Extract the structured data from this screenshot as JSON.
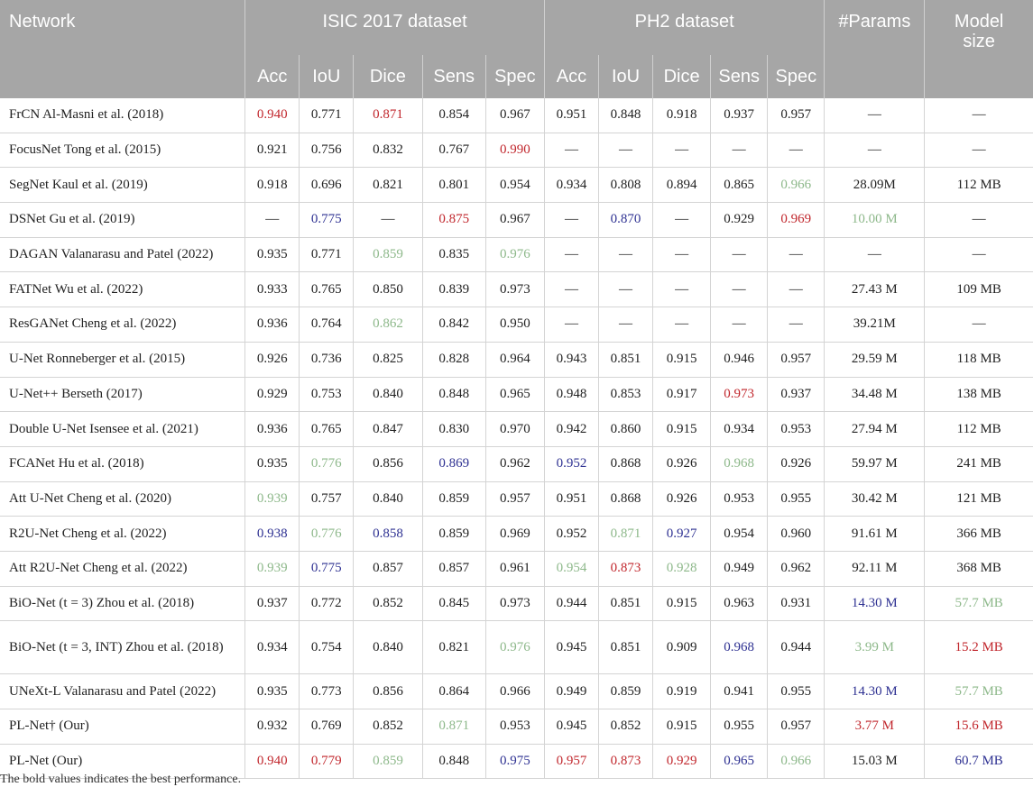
{
  "header": {
    "network": "Network",
    "group1": "ISIC 2017 dataset",
    "group2": "PH2 dataset",
    "params": "#Params",
    "model_size_line1": "Model",
    "model_size_line2": "size",
    "metrics": [
      "Acc",
      "IoU",
      "Dice",
      "Sens",
      "Spec"
    ]
  },
  "colors": {
    "header_bg": "#a6a6a6",
    "red": "#c1272d",
    "blue": "#2e3192",
    "green": "#8db88a"
  },
  "rows": [
    {
      "name": "FrCN Al-Masni et al. (2018)",
      "cells": [
        {
          "v": "0.940",
          "c": "red"
        },
        {
          "v": "0.771"
        },
        {
          "v": "0.871",
          "c": "red"
        },
        {
          "v": "0.854"
        },
        {
          "v": "0.967"
        },
        {
          "v": "0.951"
        },
        {
          "v": "0.848"
        },
        {
          "v": "0.918"
        },
        {
          "v": "0.937"
        },
        {
          "v": "0.957"
        },
        {
          "v": "—"
        },
        {
          "v": "—"
        }
      ]
    },
    {
      "name": "FocusNet Tong et al. (2015)",
      "cells": [
        {
          "v": "0.921"
        },
        {
          "v": "0.756"
        },
        {
          "v": "0.832"
        },
        {
          "v": "0.767"
        },
        {
          "v": "0.990",
          "c": "red"
        },
        {
          "v": "—"
        },
        {
          "v": "—"
        },
        {
          "v": "—"
        },
        {
          "v": "—"
        },
        {
          "v": "—"
        },
        {
          "v": "—"
        },
        {
          "v": "—"
        }
      ]
    },
    {
      "name": "SegNet Kaul et al. (2019)",
      "cells": [
        {
          "v": "0.918"
        },
        {
          "v": "0.696"
        },
        {
          "v": "0.821"
        },
        {
          "v": "0.801"
        },
        {
          "v": "0.954"
        },
        {
          "v": "0.934"
        },
        {
          "v": "0.808"
        },
        {
          "v": "0.894"
        },
        {
          "v": "0.865"
        },
        {
          "v": "0.966",
          "c": "green"
        },
        {
          "v": "28.09M"
        },
        {
          "v": "112 MB"
        }
      ]
    },
    {
      "name": "DSNet Gu et al. (2019)",
      "cells": [
        {
          "v": "—"
        },
        {
          "v": "0.775",
          "c": "blue"
        },
        {
          "v": "—"
        },
        {
          "v": "0.875",
          "c": "red"
        },
        {
          "v": "0.967"
        },
        {
          "v": "—"
        },
        {
          "v": "0.870",
          "c": "blue"
        },
        {
          "v": "—"
        },
        {
          "v": "0.929"
        },
        {
          "v": "0.969",
          "c": "red"
        },
        {
          "v": "10.00 M",
          "c": "green"
        },
        {
          "v": "—"
        }
      ]
    },
    {
      "name": "DAGAN Valanarasu and Patel (2022)",
      "cells": [
        {
          "v": "0.935"
        },
        {
          "v": "0.771"
        },
        {
          "v": "0.859",
          "c": "green"
        },
        {
          "v": "0.835"
        },
        {
          "v": "0.976",
          "c": "green"
        },
        {
          "v": "—"
        },
        {
          "v": "—"
        },
        {
          "v": "—"
        },
        {
          "v": "—"
        },
        {
          "v": "—"
        },
        {
          "v": "—"
        },
        {
          "v": "—"
        }
      ]
    },
    {
      "name": "FATNet Wu et al. (2022)",
      "cells": [
        {
          "v": "0.933"
        },
        {
          "v": "0.765"
        },
        {
          "v": "0.850"
        },
        {
          "v": "0.839"
        },
        {
          "v": "0.973"
        },
        {
          "v": "—"
        },
        {
          "v": "—"
        },
        {
          "v": "—"
        },
        {
          "v": "—"
        },
        {
          "v": "—"
        },
        {
          "v": "27.43 M"
        },
        {
          "v": "109 MB"
        }
      ]
    },
    {
      "name": "ResGANet Cheng et al. (2022)",
      "cells": [
        {
          "v": "0.936"
        },
        {
          "v": "0.764"
        },
        {
          "v": "0.862",
          "c": "green"
        },
        {
          "v": "0.842"
        },
        {
          "v": "0.950"
        },
        {
          "v": "—"
        },
        {
          "v": "—"
        },
        {
          "v": "—"
        },
        {
          "v": "—"
        },
        {
          "v": "—"
        },
        {
          "v": "39.21M"
        },
        {
          "v": "—"
        }
      ]
    },
    {
      "name": "U-Net Ronneberger et al. (2015)",
      "cells": [
        {
          "v": "0.926"
        },
        {
          "v": "0.736"
        },
        {
          "v": "0.825"
        },
        {
          "v": "0.828"
        },
        {
          "v": "0.964"
        },
        {
          "v": "0.943"
        },
        {
          "v": "0.851"
        },
        {
          "v": "0.915"
        },
        {
          "v": "0.946"
        },
        {
          "v": "0.957"
        },
        {
          "v": "29.59 M"
        },
        {
          "v": "118 MB"
        }
      ]
    },
    {
      "name": "U-Net++ Berseth (2017)",
      "cells": [
        {
          "v": "0.929"
        },
        {
          "v": "0.753"
        },
        {
          "v": "0.840"
        },
        {
          "v": "0.848"
        },
        {
          "v": "0.965"
        },
        {
          "v": "0.948"
        },
        {
          "v": "0.853"
        },
        {
          "v": "0.917"
        },
        {
          "v": "0.973",
          "c": "red"
        },
        {
          "v": "0.937"
        },
        {
          "v": "34.48 M"
        },
        {
          "v": "138 MB"
        }
      ]
    },
    {
      "name": "Double U-Net Isensee et al. (2021)",
      "cells": [
        {
          "v": "0.936"
        },
        {
          "v": "0.765"
        },
        {
          "v": "0.847"
        },
        {
          "v": "0.830"
        },
        {
          "v": "0.970"
        },
        {
          "v": "0.942"
        },
        {
          "v": "0.860"
        },
        {
          "v": "0.915"
        },
        {
          "v": "0.934"
        },
        {
          "v": "0.953"
        },
        {
          "v": "27.94 M"
        },
        {
          "v": "112 MB"
        }
      ]
    },
    {
      "name": "FCANet Hu et al. (2018)",
      "cells": [
        {
          "v": "0.935"
        },
        {
          "v": "0.776",
          "c": "green"
        },
        {
          "v": "0.856"
        },
        {
          "v": "0.869",
          "c": "blue"
        },
        {
          "v": "0.962"
        },
        {
          "v": "0.952",
          "c": "blue"
        },
        {
          "v": "0.868"
        },
        {
          "v": "0.926"
        },
        {
          "v": "0.968",
          "c": "green"
        },
        {
          "v": "0.926"
        },
        {
          "v": "59.97 M"
        },
        {
          "v": "241 MB"
        }
      ]
    },
    {
      "name": "Att U-Net Cheng et al. (2020)",
      "cells": [
        {
          "v": "0.939",
          "c": "green"
        },
        {
          "v": "0.757"
        },
        {
          "v": "0.840"
        },
        {
          "v": "0.859"
        },
        {
          "v": "0.957"
        },
        {
          "v": "0.951"
        },
        {
          "v": "0.868"
        },
        {
          "v": "0.926"
        },
        {
          "v": "0.953"
        },
        {
          "v": "0.955"
        },
        {
          "v": "30.42 M"
        },
        {
          "v": "121 MB"
        }
      ]
    },
    {
      "name": "R2U-Net Cheng et al. (2022)",
      "cells": [
        {
          "v": "0.938",
          "c": "blue"
        },
        {
          "v": "0.776",
          "c": "green"
        },
        {
          "v": "0.858",
          "c": "blue"
        },
        {
          "v": "0.859"
        },
        {
          "v": "0.969"
        },
        {
          "v": "0.952"
        },
        {
          "v": "0.871",
          "c": "green"
        },
        {
          "v": "0.927",
          "c": "blue"
        },
        {
          "v": "0.954"
        },
        {
          "v": "0.960"
        },
        {
          "v": "91.61 M"
        },
        {
          "v": "366 MB"
        }
      ]
    },
    {
      "name": "Att R2U-Net Cheng et al. (2022)",
      "cells": [
        {
          "v": "0.939",
          "c": "green"
        },
        {
          "v": "0.775",
          "c": "blue"
        },
        {
          "v": "0.857"
        },
        {
          "v": "0.857"
        },
        {
          "v": "0.961"
        },
        {
          "v": "0.954",
          "c": "green"
        },
        {
          "v": "0.873",
          "c": "red"
        },
        {
          "v": "0.928",
          "c": "green"
        },
        {
          "v": "0.949"
        },
        {
          "v": "0.962"
        },
        {
          "v": "92.11 M"
        },
        {
          "v": "368 MB"
        }
      ]
    },
    {
      "name": "BiO-Net (t = 3) Zhou et al. (2018)",
      "cells": [
        {
          "v": "0.937"
        },
        {
          "v": "0.772"
        },
        {
          "v": "0.852"
        },
        {
          "v": "0.845"
        },
        {
          "v": "0.973"
        },
        {
          "v": "0.944"
        },
        {
          "v": "0.851"
        },
        {
          "v": "0.915"
        },
        {
          "v": "0.963"
        },
        {
          "v": "0.931"
        },
        {
          "v": "14.30 M",
          "c": "blue"
        },
        {
          "v": "57.7 MB",
          "c": "green"
        }
      ]
    },
    {
      "name": "BiO-Net (t = 3, INT) Zhou et al. (2018)",
      "tall": true,
      "cells": [
        {
          "v": "0.934"
        },
        {
          "v": "0.754"
        },
        {
          "v": "0.840"
        },
        {
          "v": "0.821"
        },
        {
          "v": "0.976",
          "c": "green"
        },
        {
          "v": "0.945"
        },
        {
          "v": "0.851"
        },
        {
          "v": "0.909"
        },
        {
          "v": "0.968",
          "c": "blue"
        },
        {
          "v": "0.944"
        },
        {
          "v": "3.99 M",
          "c": "green"
        },
        {
          "v": "15.2 MB",
          "c": "red"
        }
      ]
    },
    {
      "name": "UNeXt-L Valanarasu and Patel (2022)",
      "cells": [
        {
          "v": "0.935"
        },
        {
          "v": "0.773"
        },
        {
          "v": "0.856"
        },
        {
          "v": "0.864"
        },
        {
          "v": "0.966"
        },
        {
          "v": "0.949"
        },
        {
          "v": "0.859"
        },
        {
          "v": "0.919"
        },
        {
          "v": "0.941"
        },
        {
          "v": "0.955"
        },
        {
          "v": "14.30 M",
          "c": "blue"
        },
        {
          "v": "57.7 MB",
          "c": "green"
        }
      ]
    },
    {
      "name": "PL-Net† (Our)",
      "cells": [
        {
          "v": "0.932"
        },
        {
          "v": "0.769"
        },
        {
          "v": "0.852"
        },
        {
          "v": "0.871",
          "c": "green"
        },
        {
          "v": "0.953"
        },
        {
          "v": "0.945"
        },
        {
          "v": "0.852"
        },
        {
          "v": "0.915"
        },
        {
          "v": "0.955"
        },
        {
          "v": "0.957"
        },
        {
          "v": "3.77 M",
          "c": "red"
        },
        {
          "v": "15.6 MB",
          "c": "red"
        }
      ]
    },
    {
      "name": "PL-Net (Our)",
      "cells": [
        {
          "v": "0.940",
          "c": "red"
        },
        {
          "v": "0.779",
          "c": "red"
        },
        {
          "v": "0.859",
          "c": "green"
        },
        {
          "v": "0.848"
        },
        {
          "v": "0.975",
          "c": "blue"
        },
        {
          "v": "0.957",
          "c": "red"
        },
        {
          "v": "0.873",
          "c": "red"
        },
        {
          "v": "0.929",
          "c": "red"
        },
        {
          "v": "0.965",
          "c": "blue"
        },
        {
          "v": "0.966",
          "c": "green"
        },
        {
          "v": "15.03 M"
        },
        {
          "v": "60.7 MB",
          "c": "blue"
        }
      ]
    }
  ],
  "footnote": "The bold values indicates the best performance."
}
